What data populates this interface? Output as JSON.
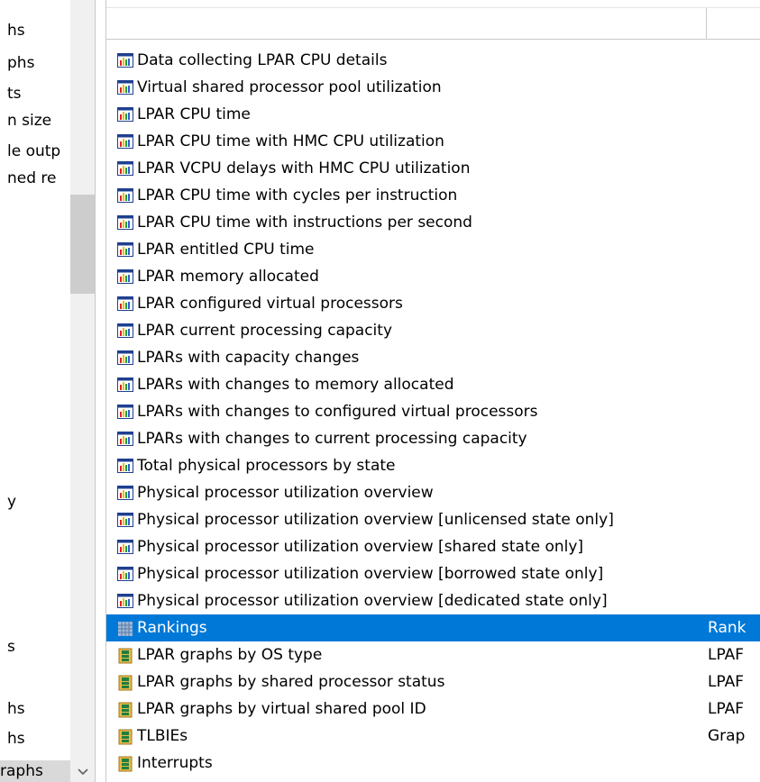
{
  "left_panel": {
    "items": [
      "hs",
      "phs",
      "ts",
      "n size",
      "le outp",
      "ned re",
      "y",
      "s",
      "hs",
      "hs",
      "raphs"
    ],
    "selected_index": 10
  },
  "list": {
    "rows": [
      {
        "label": "Data collecting LPAR CPU details",
        "type": "",
        "icon": "bar-chart-icon"
      },
      {
        "label": "Virtual shared processor pool utilization",
        "type": "",
        "icon": "bar-chart-icon"
      },
      {
        "label": "LPAR CPU time",
        "type": "",
        "icon": "bar-chart-icon"
      },
      {
        "label": "LPAR CPU time with HMC CPU utilization",
        "type": "",
        "icon": "bar-chart-icon"
      },
      {
        "label": "LPAR VCPU delays with HMC CPU utilization",
        "type": "",
        "icon": "bar-chart-icon"
      },
      {
        "label": "LPAR CPU time with cycles per instruction",
        "type": "",
        "icon": "bar-chart-icon"
      },
      {
        "label": "LPAR CPU time with instructions per second",
        "type": "",
        "icon": "bar-chart-icon"
      },
      {
        "label": "LPAR entitled CPU time",
        "type": "",
        "icon": "bar-chart-icon"
      },
      {
        "label": "LPAR memory allocated",
        "type": "",
        "icon": "bar-chart-icon"
      },
      {
        "label": "LPAR configured virtual processors",
        "type": "",
        "icon": "bar-chart-icon"
      },
      {
        "label": "LPAR current processing capacity",
        "type": "",
        "icon": "bar-chart-icon"
      },
      {
        "label": "LPARs with capacity changes",
        "type": "",
        "icon": "bar-chart-icon"
      },
      {
        "label": "LPARs with changes to memory allocated",
        "type": "",
        "icon": "bar-chart-icon"
      },
      {
        "label": "LPARs with changes to configured virtual processors",
        "type": "",
        "icon": "bar-chart-icon"
      },
      {
        "label": "LPARs with changes to current processing capacity",
        "type": "",
        "icon": "bar-chart-icon"
      },
      {
        "label": "Total physical processors by state",
        "type": "",
        "icon": "bar-chart-icon"
      },
      {
        "label": "Physical processor utilization overview",
        "type": "",
        "icon": "bar-chart-icon"
      },
      {
        "label": "Physical processor utilization overview [unlicensed state only]",
        "type": "",
        "icon": "bar-chart-icon"
      },
      {
        "label": "Physical processor utilization overview [shared state only]",
        "type": "",
        "icon": "bar-chart-icon"
      },
      {
        "label": "Physical processor utilization overview [borrowed state only]",
        "type": "",
        "icon": "bar-chart-icon"
      },
      {
        "label": "Physical processor utilization overview [dedicated state only]",
        "type": "",
        "icon": "bar-chart-icon"
      },
      {
        "label": "Rankings",
        "type": "Rank",
        "icon": "grid-icon"
      },
      {
        "label": "LPAR graphs by OS type",
        "type": "LPAF",
        "icon": "folder-chart-icon"
      },
      {
        "label": "LPAR graphs by shared processor status",
        "type": "LPAF",
        "icon": "folder-chart-icon"
      },
      {
        "label": "LPAR graphs by virtual shared pool ID",
        "type": "LPAF",
        "icon": "folder-chart-icon"
      },
      {
        "label": "TLBIEs",
        "type": "Grap",
        "icon": "folder-chart-icon"
      },
      {
        "label": "Interrupts",
        "type": "",
        "icon": "folder-chart-icon"
      }
    ],
    "selected_index": 21
  },
  "colors": {
    "selection": "#0078d7",
    "left_selection": "#d9d9d9",
    "scrollbar_track": "#f0f0f0",
    "scrollbar_thumb": "#cdcdcd"
  }
}
